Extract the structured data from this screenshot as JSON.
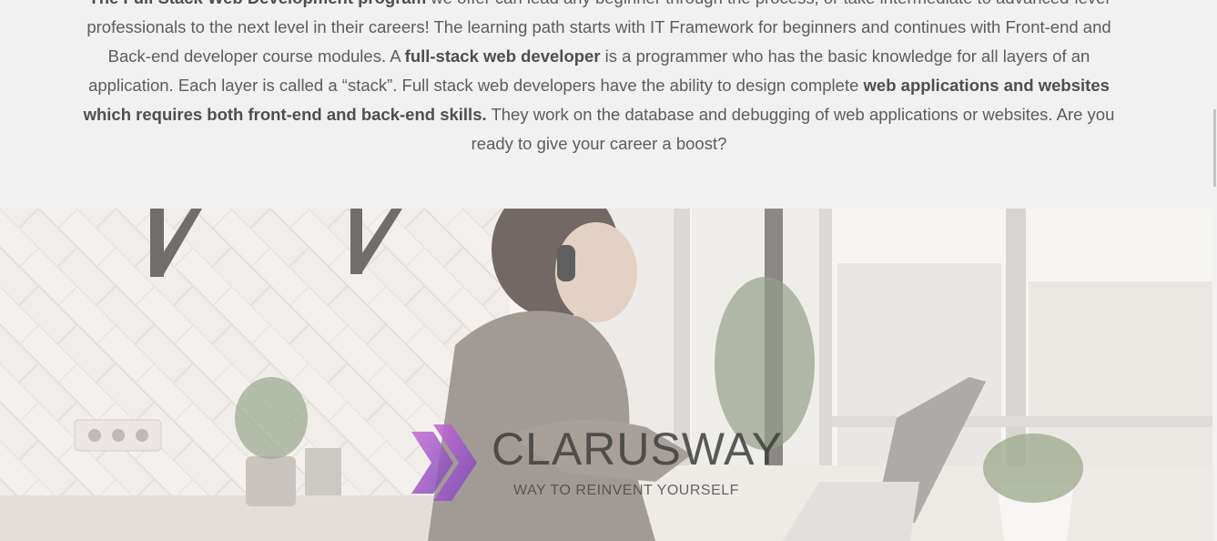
{
  "intro": {
    "p1_bold": "The Full Stack Web Development program",
    "p1_text": " we offer can lead any beginner through the process, or take intermediate to advanced-level professionals to the next level in their careers! The learning path starts with IT Framework for beginners and continues with Front-end and Back-end developer course modules. A ",
    "p2_bold": "full-stack web developer",
    "p2_text": " is a programmer who has the basic knowledge for all layers of an application. Each layer is called a “stack”. Full stack web developers have the ability to design complete ",
    "p3_bold": "web applications and websites which requires both front-end and back-end skills.",
    "p3_text": " They work on the database and debugging of web applications or websites. Are you ready to give your career a boost?"
  },
  "hero": {
    "logo_name": "CLARUSWAY",
    "logo_tagline": "WAY TO REINVENT YOURSELF",
    "logo_icon": "double-chevron-icon",
    "accent_color": "#9b59c6"
  }
}
